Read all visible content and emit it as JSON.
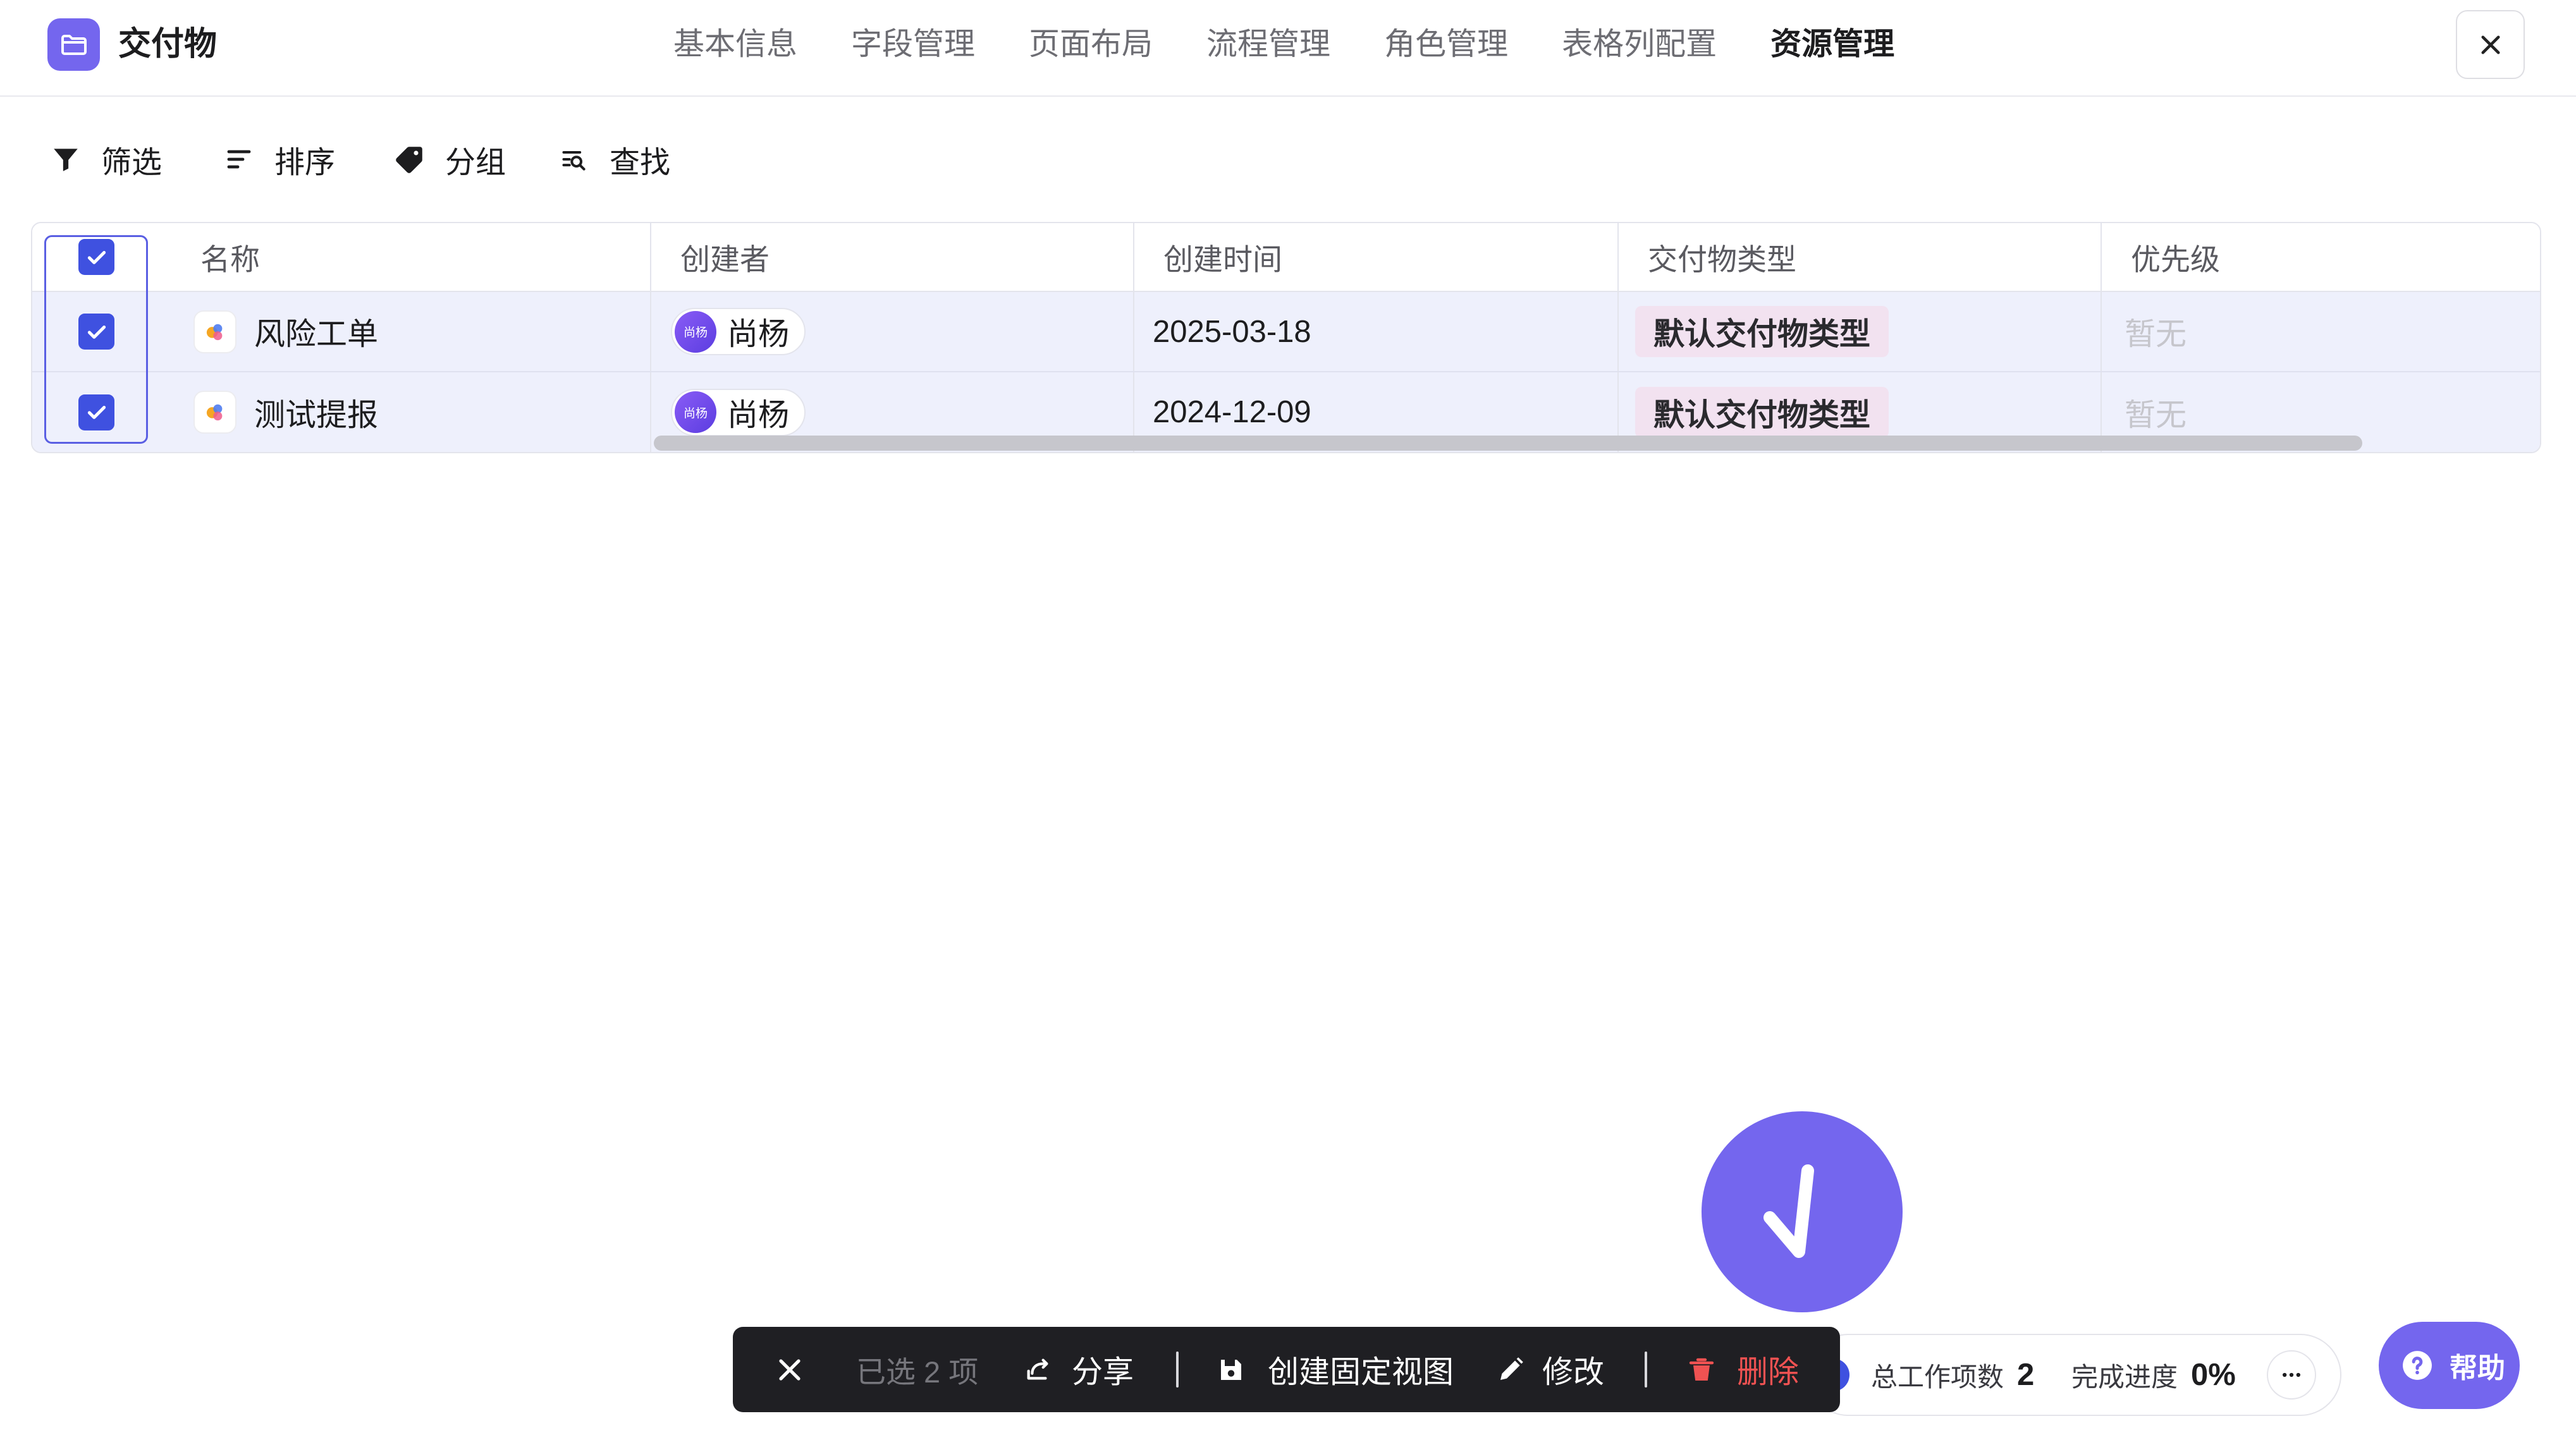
{
  "colors": {
    "accent": "#7466ee",
    "checkbox": "#3f51e0",
    "danger": "#f05252",
    "tag_bg": "#f2e2f0",
    "row_selected_bg": "#eef0fc",
    "action_bar_bg": "#1f1f23"
  },
  "header": {
    "app_icon": "folder-icon",
    "title": "交付物",
    "tabs": [
      {
        "label": "基本信息",
        "active": false
      },
      {
        "label": "字段管理",
        "active": false
      },
      {
        "label": "页面布局",
        "active": false
      },
      {
        "label": "流程管理",
        "active": false
      },
      {
        "label": "角色管理",
        "active": false
      },
      {
        "label": "表格列配置",
        "active": false
      },
      {
        "label": "资源管理",
        "active": true
      }
    ],
    "close_icon": "close-icon"
  },
  "toolbar": {
    "items": [
      {
        "icon": "filter-icon",
        "label": "筛选"
      },
      {
        "icon": "sort-icon",
        "label": "排序"
      },
      {
        "icon": "tag-icon",
        "label": "分组"
      },
      {
        "icon": "find-icon",
        "label": "查找"
      }
    ]
  },
  "table": {
    "select_all_checked": true,
    "columns": [
      "名称",
      "创建者",
      "创建时间",
      "交付物类型",
      "优先级"
    ],
    "rows": [
      {
        "checked": true,
        "icon": "deliverable-icon",
        "name": "风险工单",
        "creator": {
          "avatar_text": "尚杨",
          "name": "尚杨"
        },
        "created_at": "2025-03-18",
        "type": "默认交付物类型",
        "priority": "暂无"
      },
      {
        "checked": true,
        "icon": "deliverable-icon",
        "name": "测试提报",
        "creator": {
          "avatar_text": "尚杨",
          "name": "尚杨"
        },
        "created_at": "2024-12-09",
        "type": "默认交付物类型",
        "priority": "暂无"
      }
    ]
  },
  "fab": {
    "icon": "arrow-down-icon"
  },
  "stats": {
    "total_label": "总工作项数",
    "total_value": "2",
    "progress_label": "完成进度",
    "progress_value": "0%",
    "more_icon": "more-icon"
  },
  "selection_bar": {
    "close_icon": "close-icon",
    "selected_text": "已选 2 项",
    "actions": [
      {
        "icon": "share-icon",
        "label": "分享"
      },
      {
        "icon": "save-icon",
        "label": "创建固定视图"
      },
      {
        "icon": "edit-icon",
        "label": "修改"
      },
      {
        "icon": "trash-icon",
        "label": "删除",
        "danger": true
      }
    ]
  },
  "help": {
    "icon": "help-icon",
    "label": "帮助"
  }
}
